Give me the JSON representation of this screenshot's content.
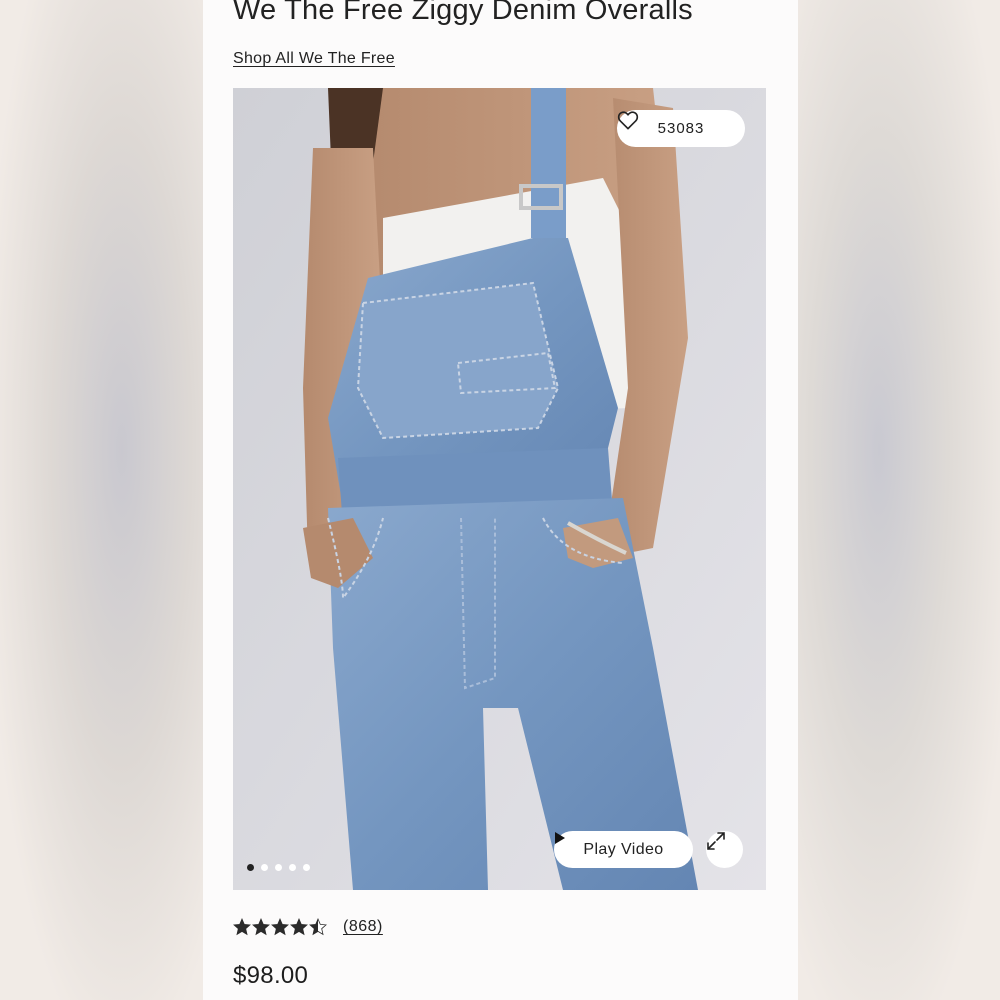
{
  "product": {
    "title": "We The Free Ziggy Denim Overalls",
    "shop_link": "Shop All We The Free",
    "favorites_count": "53083",
    "play_video_label": "Play Video",
    "rating_value": 4.5,
    "review_count": "(868)",
    "price": "$98.00"
  },
  "gallery": {
    "image_count": 5,
    "active_index": 0
  },
  "icons": {
    "favorite": "heart-icon",
    "play": "play-icon",
    "expand": "expand-icon",
    "star": "star-icon"
  },
  "colors": {
    "denim": "#7b9cc5",
    "panel_bg": "#fcfbfb",
    "photo_bg": "#d9d8dd",
    "text": "#1d1d1d"
  }
}
